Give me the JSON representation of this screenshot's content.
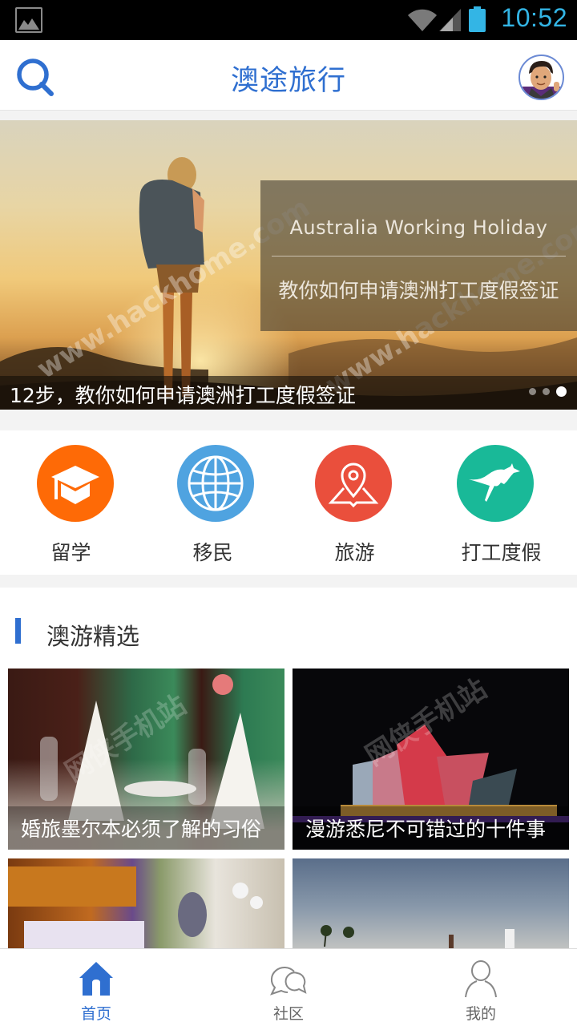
{
  "status_bar": {
    "time": "10:52",
    "icons": [
      "gallery-notification-icon",
      "wifi-icon",
      "cell-signal-icon",
      "battery-icon"
    ],
    "accent_color": "#33b5e5"
  },
  "header": {
    "title": "澳途旅行",
    "search_icon": "search-icon",
    "avatar_icon": "user-avatar",
    "brand_color": "#2f6fd0"
  },
  "banner": {
    "overlay_en": "Australia Working Holiday",
    "overlay_zh": "教你如何申请澳洲打工度假签证",
    "caption": "12步，教你如何申请澳洲打工度假签证",
    "watermark": "www.hackhome.com",
    "slide_count": 3,
    "active_slide": 3
  },
  "categories": [
    {
      "label": "留学",
      "icon": "graduation-cap-icon",
      "color": "#fe6a06"
    },
    {
      "label": "移民",
      "icon": "globe-icon",
      "color": "#4fa3e0"
    },
    {
      "label": "旅游",
      "icon": "map-pin-icon",
      "color": "#ea4f3c"
    },
    {
      "label": "打工度假",
      "icon": "kangaroo-icon",
      "color": "#19b998"
    }
  ],
  "section": {
    "title": "澳游精选",
    "watermark": "网侠手机站",
    "cards": [
      {
        "caption": "婚旅墨尔本必须了解的习俗"
      },
      {
        "caption": "漫游悉尼不可错过的十件事"
      },
      {
        "caption": ""
      },
      {
        "caption": ""
      }
    ]
  },
  "bottom_nav": {
    "tabs": [
      {
        "label": "首页",
        "icon": "home-icon",
        "active": true
      },
      {
        "label": "社区",
        "icon": "chat-bubbles-icon",
        "active": false
      },
      {
        "label": "我的",
        "icon": "person-icon",
        "active": false
      }
    ]
  }
}
